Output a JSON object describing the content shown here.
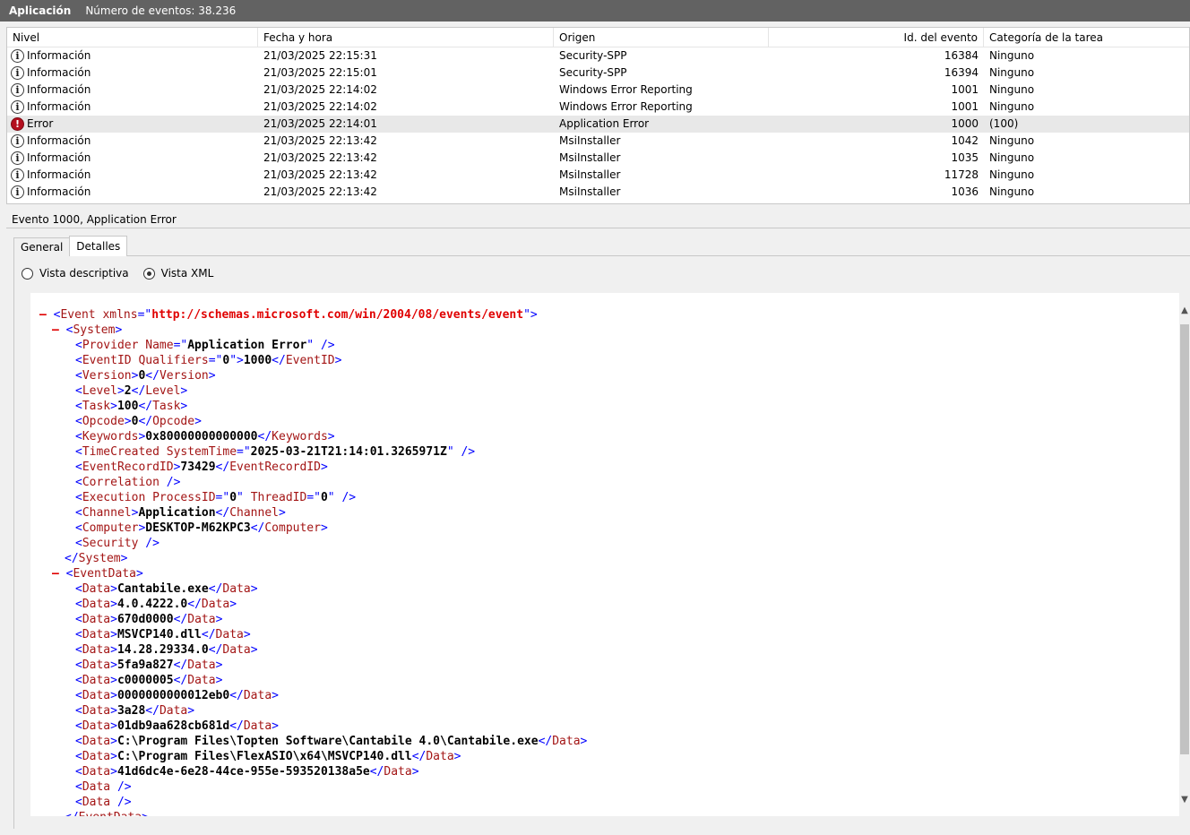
{
  "title": {
    "app": "Aplicación",
    "count": "Número de eventos: 38.236"
  },
  "list": {
    "headers": [
      "Nivel",
      "Fecha y hora",
      "Origen",
      "Id. del evento",
      "Categoría de la tarea"
    ],
    "rows": [
      {
        "level": "Información",
        "date": "21/03/2025 22:15:31",
        "source": "Security-SPP",
        "id": "16384",
        "category": "Ninguno"
      },
      {
        "level": "Información",
        "date": "21/03/2025 22:15:01",
        "source": "Security-SPP",
        "id": "16394",
        "category": "Ninguno"
      },
      {
        "level": "Información",
        "date": "21/03/2025 22:14:02",
        "source": "Windows Error Reporting",
        "id": "1001",
        "category": "Ninguno"
      },
      {
        "level": "Información",
        "date": "21/03/2025 22:14:02",
        "source": "Windows Error Reporting",
        "id": "1001",
        "category": "Ninguno"
      },
      {
        "level": "Error",
        "date": "21/03/2025 22:14:01",
        "source": "Application Error",
        "id": "1000",
        "category": "(100)"
      },
      {
        "level": "Información",
        "date": "21/03/2025 22:13:42",
        "source": "MsiInstaller",
        "id": "1042",
        "category": "Ninguno"
      },
      {
        "level": "Información",
        "date": "21/03/2025 22:13:42",
        "source": "MsiInstaller",
        "id": "1035",
        "category": "Ninguno"
      },
      {
        "level": "Información",
        "date": "21/03/2025 22:13:42",
        "source": "MsiInstaller",
        "id": "11728",
        "category": "Ninguno"
      },
      {
        "level": "Información",
        "date": "21/03/2025 22:13:42",
        "source": "MsiInstaller",
        "id": "1036",
        "category": "Ninguno"
      }
    ]
  },
  "detail": {
    "title": "Evento 1000, Application Error",
    "tabs": [
      "General",
      "Detalles"
    ],
    "radios": [
      "Vista descriptiva",
      "Vista XML"
    ]
  },
  "xml": {
    "event": {
      "attr": "xmlns",
      "value": "http://schemas.microsoft.com/win/2004/08/events/event"
    },
    "provider_name": "Application Error",
    "event_id_qualifiers": "0",
    "event_id": "1000",
    "version": "0",
    "level": "2",
    "task": "100",
    "opcode": "0",
    "keywords": "0x80000000000000",
    "time_created": "2025-03-21T21:14:01.3265971Z",
    "event_record_id": "73429",
    "process_id": "0",
    "thread_id": "0",
    "channel": "Application",
    "computer": "DESKTOP-M62KPC3",
    "data": [
      "Cantabile.exe",
      "4.0.4222.0",
      "670d0000",
      "MSVCP140.dll",
      "14.28.29334.0",
      "5fa9a827",
      "c0000005",
      "0000000000012eb0",
      "3a28",
      "01db9aa628cb681d",
      "C:\\Program Files\\Topten Software\\Cantabile 4.0\\Cantabile.exe",
      "C:\\Program Files\\FlexASIO\\x64\\MSVCP140.dll",
      "41d6dc4e-6e28-44ce-955e-593520138a5e"
    ]
  }
}
